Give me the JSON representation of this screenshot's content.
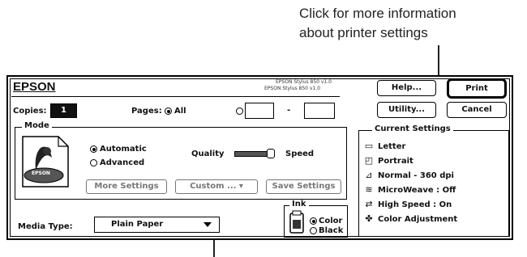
{
  "callout": {
    "line1": "Click for more information",
    "line2": "about printer settings"
  },
  "dialog": {
    "brand": "EPSON",
    "version_line1": "EPSON Stylus 850 v1.0",
    "version_line2": "EPSON Stylus 850 v1.0",
    "buttons": {
      "help": "Help...",
      "print": "Print",
      "utility": "Utility...",
      "cancel": "Cancel"
    },
    "copies_label": "Copies:",
    "copies_value": "1",
    "pages_label": "Pages:",
    "pages_all": "All",
    "pages_to": "-",
    "mode": {
      "title": "Mode",
      "automatic": "Automatic",
      "advanced": "Advanced",
      "quality": "Quality",
      "speed": "Speed",
      "more_settings": "More Settings",
      "custom": "Custom ...",
      "save_settings": "Save Settings",
      "logo_text": "EPSON"
    },
    "media_type_label": "Media Type:",
    "media_type_value": "Plain Paper",
    "ink": {
      "title": "Ink",
      "color": "Color",
      "black": "Black"
    },
    "current_settings": {
      "title": "Current Settings",
      "items": [
        {
          "label": "Letter",
          "icon": "paper-icon"
        },
        {
          "label": "Portrait",
          "icon": "portrait-icon"
        },
        {
          "label": "Normal - 360 dpi",
          "icon": "resolution-icon"
        },
        {
          "label": "MicroWeave : Off",
          "icon": "microweave-icon"
        },
        {
          "label": "High Speed : On",
          "icon": "high-speed-icon"
        },
        {
          "label": "Color Adjustment",
          "icon": "color-adjustment-icon"
        }
      ]
    }
  }
}
